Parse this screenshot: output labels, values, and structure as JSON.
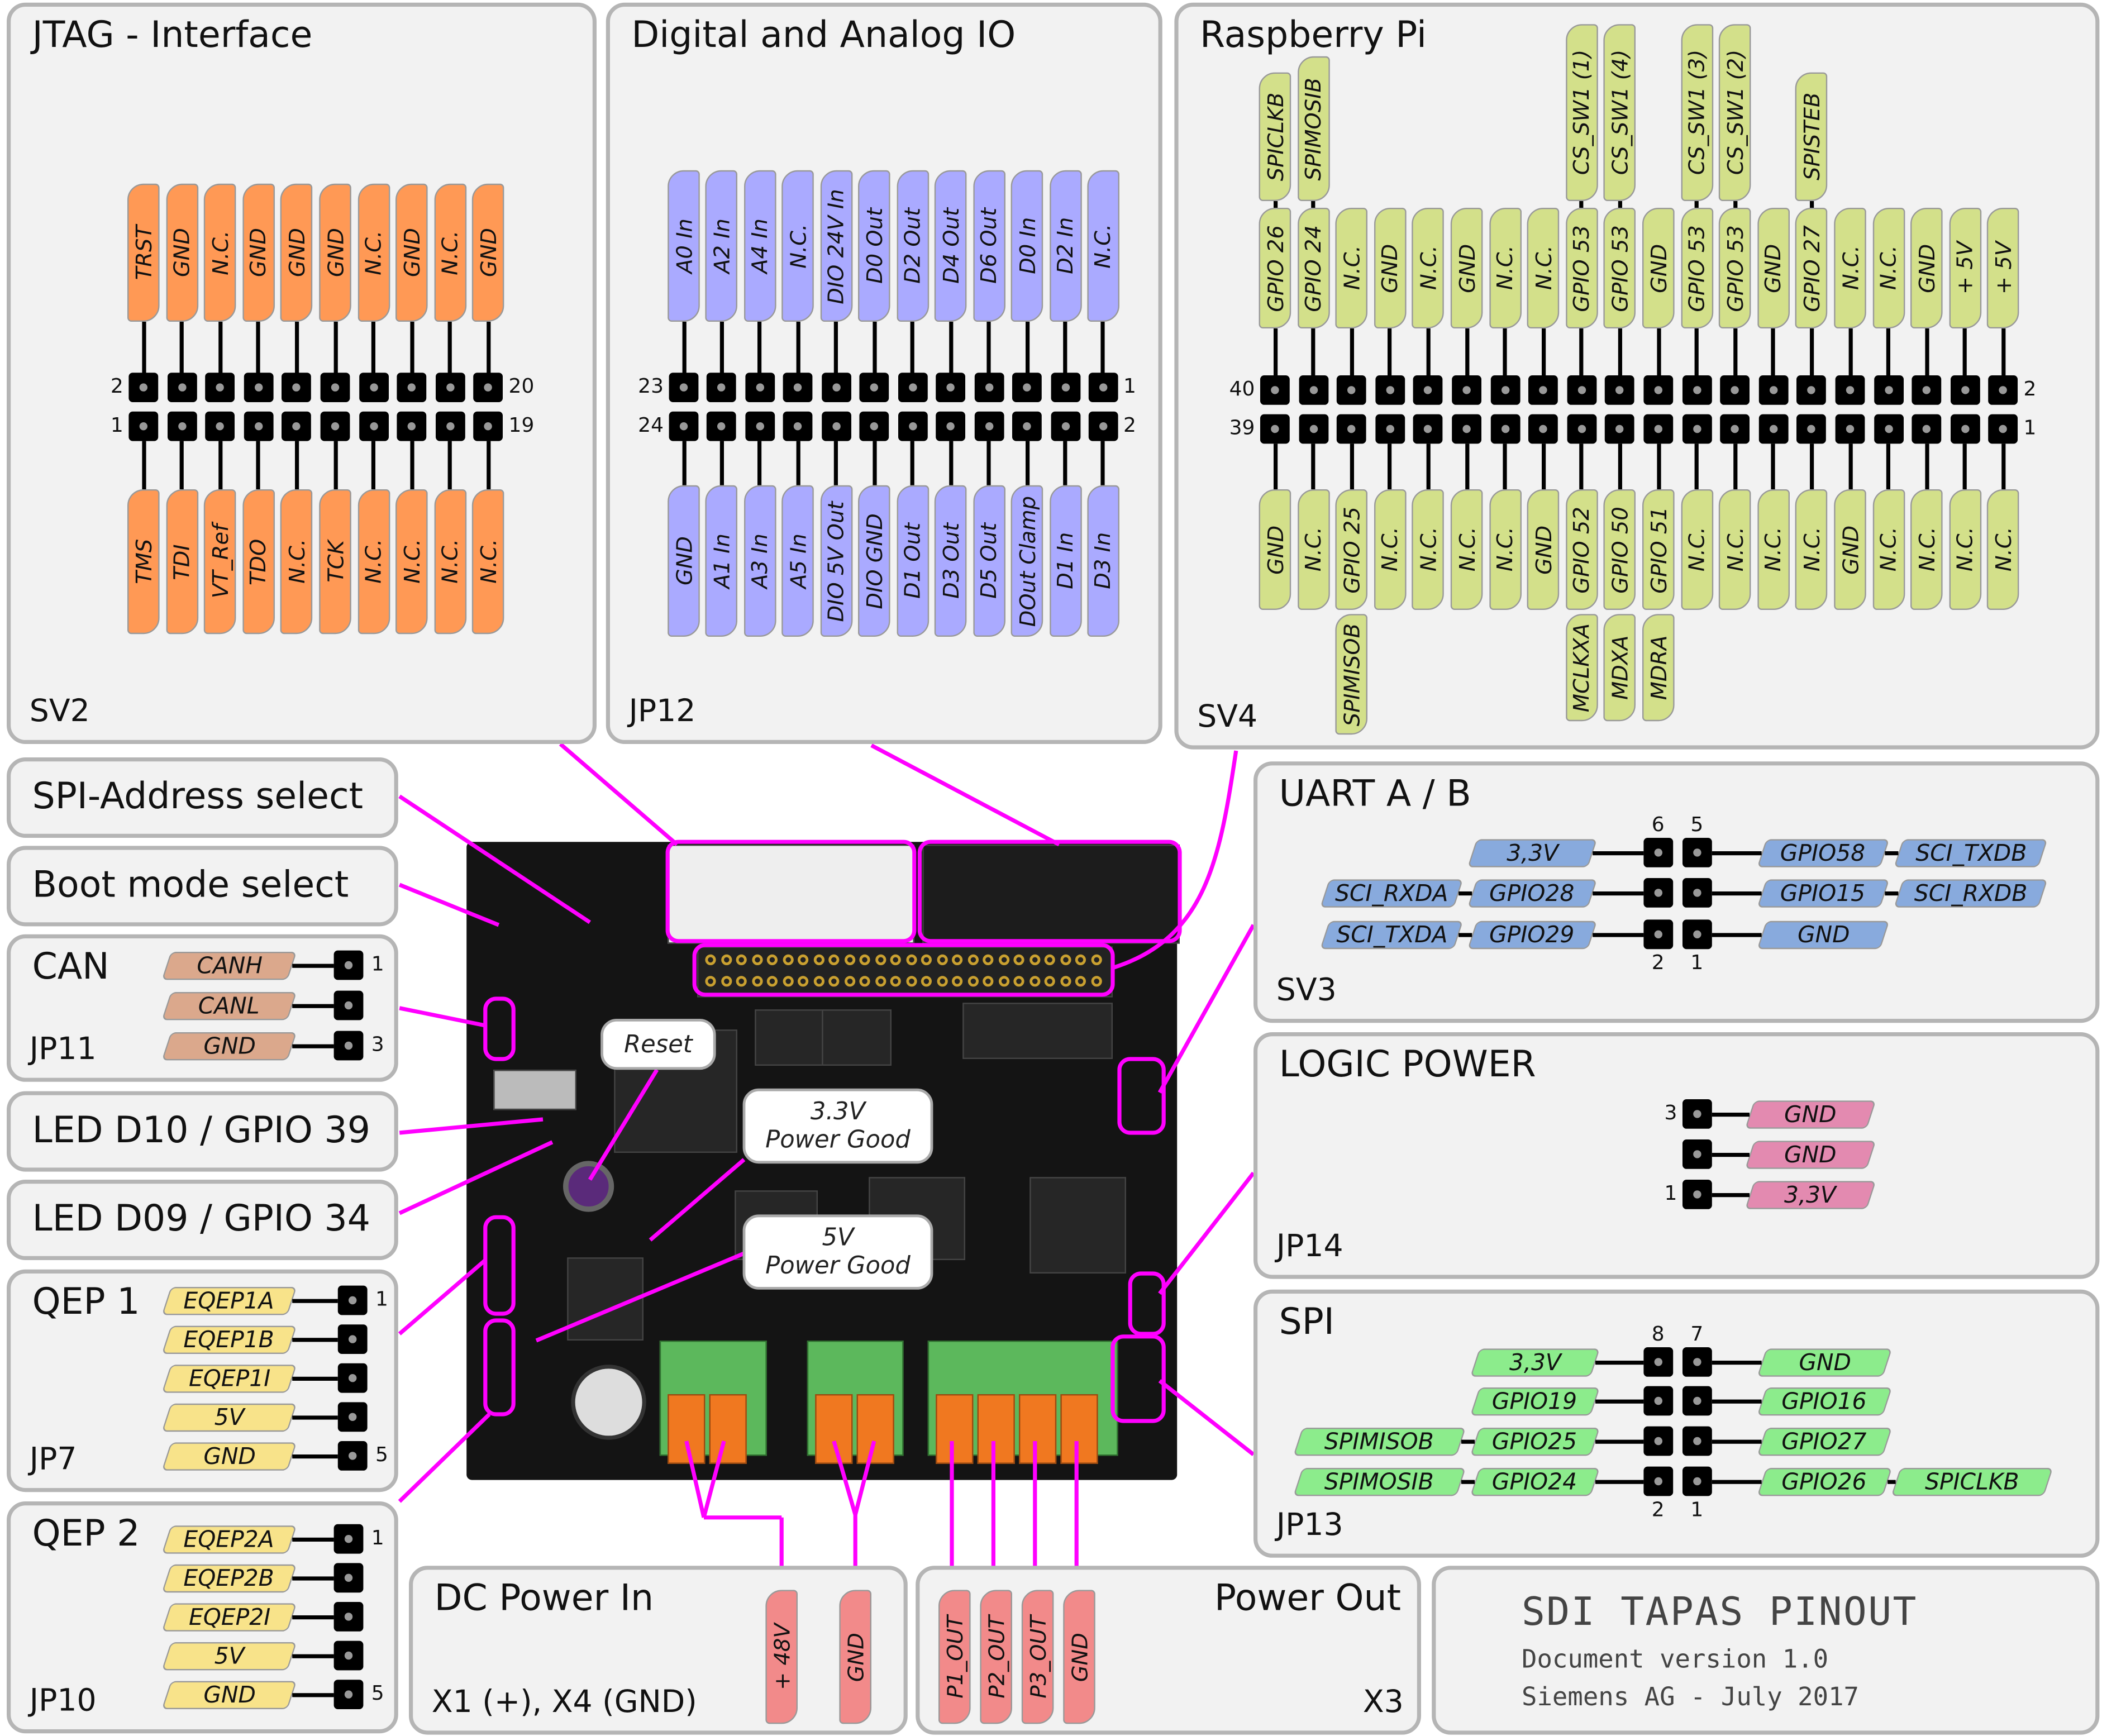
{
  "jtag": {
    "title": "JTAG - Interface",
    "ref": "SV2",
    "color": "#ff9955",
    "pin_numbers": {
      "top_left": "2",
      "top_right": "20",
      "bottom_left": "1",
      "bottom_right": "19"
    },
    "top": [
      "TRST",
      "GND",
      "N.C.",
      "GND",
      "GND",
      "GND",
      "N.C.",
      "GND",
      "N.C.",
      "GND"
    ],
    "bottom": [
      "TMS",
      "TDI",
      "VT_Ref",
      "TDO",
      "N.C.",
      "TCK",
      "N.C.",
      "N.C.",
      "N.C.",
      "N.C."
    ]
  },
  "dio": {
    "title": "Digital and Analog IO",
    "ref": "JP12",
    "color": "#aaaaff",
    "pin_numbers": {
      "top_left": "23",
      "top_right": "1",
      "bottom_left": "24",
      "bottom_right": "2"
    },
    "top": [
      "A0 In",
      "A2 In",
      "A4 In",
      "N.C.",
      "DIO 24V In",
      "D0 Out",
      "D2 Out",
      "D4 Out",
      "D6 Out",
      "D0 In",
      "D2 In",
      "N.C."
    ],
    "bottom": [
      "GND",
      "A1 In",
      "A3 In",
      "A5 In",
      "DIO 5V Out",
      "DIO GND",
      "D1 Out",
      "D3 Out",
      "D5 Out",
      "DOut Clamp",
      "D1 In",
      "D3 In"
    ]
  },
  "rpi": {
    "title": "Raspberry Pi",
    "ref": "SV4",
    "color": "#d3e08a",
    "pin_numbers": {
      "top_left": "40",
      "top_right": "2",
      "bottom_left": "39",
      "bottom_right": "1"
    },
    "top": [
      "GPIO 26",
      "GPIO 24",
      "N.C.",
      "GND",
      "N.C.",
      "GND",
      "N.C.",
      "N.C.",
      "GPIO 53",
      "GPIO 53",
      "GND",
      "GPIO 53",
      "GPIO 53",
      "GND",
      "GPIO 27",
      "N.C.",
      "N.C.",
      "GND",
      "+ 5V",
      "+ 5V"
    ],
    "top_extra": [
      "SPICLKB",
      "SPIMOSIB",
      null,
      null,
      null,
      null,
      null,
      null,
      "CS_SW1 (1)",
      "CS_SW1 (4)",
      null,
      "CS_SW1 (3)",
      "CS_SW1 (2)",
      null,
      "SPISTEB",
      null,
      null,
      null,
      null,
      null
    ],
    "bottom": [
      "GND",
      "N.C.",
      "GPIO 25",
      "N.C.",
      "N.C.",
      "N.C.",
      "N.C.",
      "GND",
      "GPIO 52",
      "GPIO 50",
      "GPIO 51",
      "N.C.",
      "N.C.",
      "N.C.",
      "N.C.",
      "GND",
      "N.C.",
      "N.C.",
      "N.C.",
      "N.C."
    ],
    "bottom_extra": [
      null,
      null,
      "SPIMISOB",
      null,
      null,
      null,
      null,
      null,
      "MCLKXA",
      "MDXA",
      "MDRA",
      null,
      null,
      null,
      null,
      null,
      null,
      null,
      null,
      null
    ]
  },
  "spi_address": {
    "title": "SPI-Address select"
  },
  "boot_mode": {
    "title": "Boot mode select"
  },
  "can": {
    "title": "CAN",
    "ref": "JP11",
    "color": "#dba88c",
    "numbers": {
      "first": "1",
      "last": "3"
    },
    "rows": [
      {
        "left": "CANH"
      },
      {
        "left": "CANL"
      },
      {
        "left": "GND"
      }
    ]
  },
  "led_d10": {
    "title": "LED D10 / GPIO 39"
  },
  "led_d09": {
    "title": "LED D09 / GPIO 34"
  },
  "qep1": {
    "title": "QEP 1",
    "ref": "JP7",
    "color": "#f8e38a",
    "numbers": {
      "first": "1",
      "last": "5"
    },
    "rows": [
      {
        "left": "EQEP1A"
      },
      {
        "left": "EQEP1B"
      },
      {
        "left": "EQEP1I"
      },
      {
        "left": "5V"
      },
      {
        "left": "GND"
      }
    ]
  },
  "qep2": {
    "title": "QEP 2",
    "ref": "JP10",
    "color": "#f8e38a",
    "numbers": {
      "first": "1",
      "last": "5"
    },
    "rows": [
      {
        "left": "EQEP2A"
      },
      {
        "left": "EQEP2B"
      },
      {
        "left": "EQEP2I"
      },
      {
        "left": "5V"
      },
      {
        "left": "GND"
      }
    ]
  },
  "uart": {
    "title": "UART A / B",
    "ref": "SV3",
    "color": "#88aadd",
    "numbers": {
      "top": [
        "6",
        "5"
      ],
      "bottom": [
        "2",
        "1"
      ]
    },
    "rows": [
      {
        "left": "3,3V",
        "right": "GPIO58",
        "right2": "SCI_TXDB"
      },
      {
        "left2": "SCI_RXDA",
        "left": "GPIO28",
        "right": "GPIO15",
        "right2": "SCI_RXDB"
      },
      {
        "left2": "SCI_TXDA",
        "left": "GPIO29",
        "right": "GND"
      }
    ]
  },
  "logic": {
    "title": "LOGIC POWER",
    "ref": "JP14",
    "color": "#e38ab0",
    "numbers": {
      "first": "3",
      "last": "1"
    },
    "rows": [
      {
        "right": "GND"
      },
      {
        "right": "GND"
      },
      {
        "right": "3,3V"
      }
    ]
  },
  "spi": {
    "title": "SPI",
    "ref": "JP13",
    "color": "#8cec8c",
    "numbers": {
      "top": [
        "8",
        "7"
      ],
      "bottom": [
        "2",
        "1"
      ]
    },
    "rows": [
      {
        "left": "3,3V",
        "right": "GND"
      },
      {
        "left": "GPIO19",
        "right": "GPIO16"
      },
      {
        "left2": "SPIMISOB",
        "left": "GPIO25",
        "right": "GPIO27"
      },
      {
        "left2": "SPIMOSIB",
        "left": "GPIO24",
        "right": "GPIO26",
        "right2": "SPICLKB"
      }
    ]
  },
  "dc_in": {
    "title": "DC Power In",
    "ref": "X1 (+), X4 (GND)",
    "color": "#f28a8a",
    "labels": [
      "+ 48V",
      "GND"
    ]
  },
  "power_out": {
    "title": "Power Out",
    "ref": "X3",
    "color": "#f28a8a",
    "labels": [
      "P1_OUT",
      "P2_OUT",
      "P3_OUT",
      "GND"
    ]
  },
  "titleblock": {
    "title": "SDI TAPAS PINOUT",
    "version": "Document version 1.0",
    "author": "Siemens AG - July 2017"
  },
  "callouts": {
    "reset": "Reset",
    "pg33_line1": "3.3V",
    "pg33_line2": "Power Good",
    "pg5_line1": "5V",
    "pg5_line2": "Power Good"
  },
  "accent": "#ff00ff"
}
